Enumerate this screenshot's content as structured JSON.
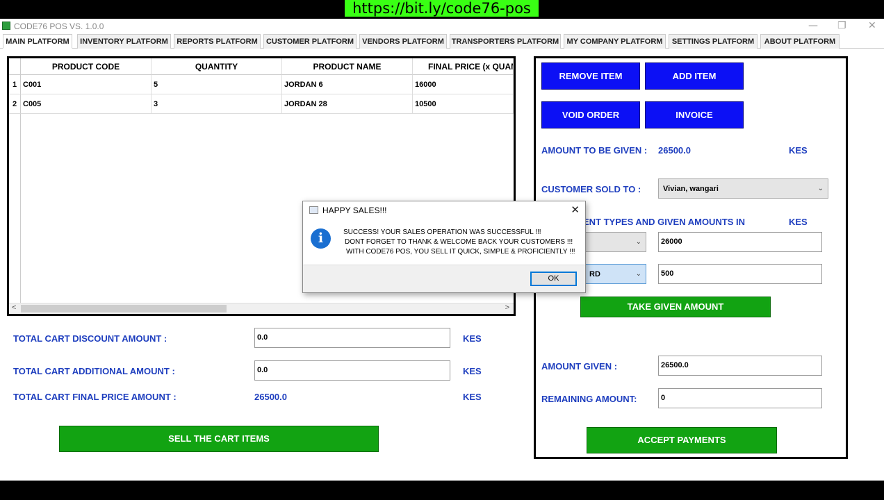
{
  "window": {
    "title": "CODE76 POS VS. 1.0.0",
    "url_banner": "https://bit.ly/code76-pos",
    "minimize_glyph": "—",
    "restore_glyph": "❐",
    "close_glyph": "✕"
  },
  "tabs": [
    {
      "label": "MAIN PLATFORM"
    },
    {
      "label": "INVENTORY PLATFORM"
    },
    {
      "label": "REPORTS PLATFORM"
    },
    {
      "label": "CUSTOMER PLATFORM"
    },
    {
      "label": "VENDORS PLATFORM"
    },
    {
      "label": "TRANSPORTERS PLATFORM"
    },
    {
      "label": "MY COMPANY PLATFORM"
    },
    {
      "label": "SETTINGS PLATFORM"
    },
    {
      "label": "ABOUT PLATFORM"
    }
  ],
  "cart": {
    "columns": [
      "PRODUCT CODE",
      "QUANTITY",
      "PRODUCT NAME",
      "FINAL PRICE (x QUANTI"
    ],
    "rows": [
      {
        "num": "1",
        "code": "C001",
        "quantity": "5",
        "name": "JORDAN 6",
        "final_price": "16000"
      },
      {
        "num": "2",
        "code": "C005",
        "quantity": "3",
        "name": "JORDAN 28",
        "final_price": "10500"
      }
    ],
    "scroll_left": "<",
    "scroll_right": ">"
  },
  "totals": {
    "discount_label": "TOTAL CART  DISCOUNT AMOUNT  :",
    "discount_value": "0.0",
    "additional_label": "TOTAL CART  ADDITIONAL AMOUNT  :",
    "additional_value": "0.0",
    "final_label": "TOTAL CART FINAL PRICE AMOUNT  :",
    "final_value": "26500.0",
    "currency": "KES",
    "sell_button": "SELL THE CART ITEMS"
  },
  "payment": {
    "remove_item": "REMOVE ITEM",
    "add_item": "ADD ITEM",
    "void_order": "VOID ORDER",
    "invoice": "INVOICE",
    "amount_to_be_given_label": "AMOUNT TO BE GIVEN :",
    "amount_to_be_given_value": "26500.0",
    "currency": "KES",
    "customer_label": "CUSTOMER SOLD TO :",
    "customer_value": "Vivian, wangari",
    "payment_types_label": "ENT TYPES AND GIVEN AMOUNTS IN",
    "payment_type_2_partial": "RD",
    "given_amount_1": "26000",
    "given_amount_2": "500",
    "take_given_amount": "TAKE GIVEN AMOUNT",
    "amount_given_label": "AMOUNT GIVEN  :",
    "amount_given_value": "26500.0",
    "remaining_label": "REMAINING AMOUNT:",
    "remaining_value": "0",
    "accept_payments": "ACCEPT PAYMENTS",
    "caret": "⌄"
  },
  "dialog": {
    "title": "HAPPY SALES!!!",
    "close_glyph": "✕",
    "info_glyph": "i",
    "line1": "SUCCESS! YOUR SALES OPERATION WAS SUCCESSFUL !!!",
    "line2": "DONT FORGET TO THANK & WELCOME BACK YOUR CUSTOMERS !!!",
    "line3": "WITH CODE76 POS, YOU SELL IT QUICK, SIMPLE & PROFICIENTLY !!!",
    "ok": "OK"
  }
}
